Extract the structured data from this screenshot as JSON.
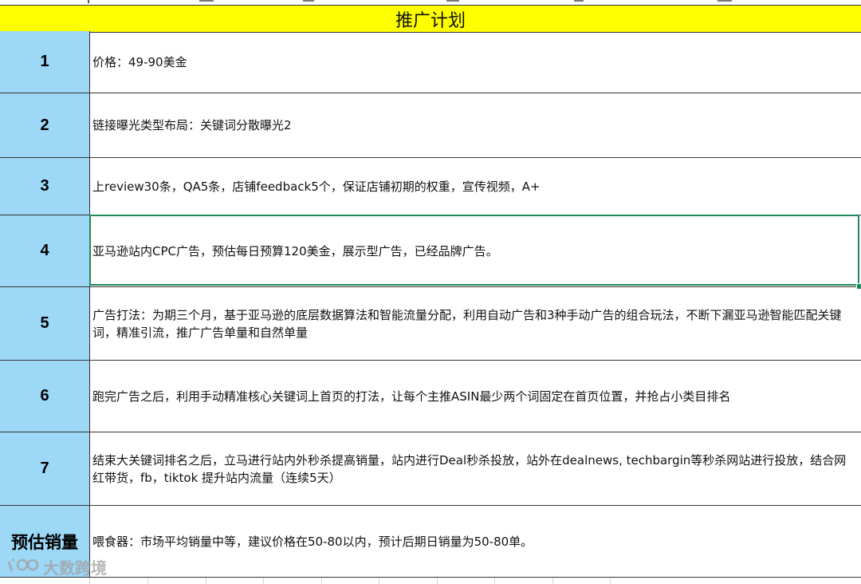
{
  "title": "推广计划",
  "rows": [
    {
      "num": "1",
      "text": "价格：49-90美金"
    },
    {
      "num": "2",
      "text": "链接曝光类型布局：关键词分散曝光2"
    },
    {
      "num": "3",
      "text": "上review30条，QA5条，店铺feedback5个，保证店铺初期的权重，宣传视频，A+"
    },
    {
      "num": "4",
      "text": "亚马逊站内CPC广告，预估每日预算120美金，展示型广告，已经品牌广告。"
    },
    {
      "num": "5",
      "text": "广告打法：为期三个月，基于亚马逊的底层数据算法和智能流量分配，利用自动广告和3种手动广告的组合玩法，不断下漏亚马逊智能匹配关键词，精准引流，推广广告单量和自然单量"
    },
    {
      "num": "6",
      "text": "跑完广告之后，利用手动精准核心关键词上首页的打法，让每个主推ASIN最少两个词固定在首页位置，并抢占小类目排名"
    },
    {
      "num": "7",
      "text": "结束大关键词排名之后，立马进行站内外秒杀提高销量，站内进行Deal秒杀投放，站外在dealnews, techbargin等秒杀网站进行投放，结合网红带货，fb，tiktok 提升站内流量（连续5天）"
    },
    {
      "num": "预估销量",
      "text": "喂食器：市场平均销量中等，建议价格在50-80以内，预计后期日销量为50-80单。"
    }
  ],
  "watermark": {
    "text": "大数跨境",
    "icon": "logo-icon"
  },
  "colors": {
    "title_bg": "#ffff00",
    "num_bg": "#9dd8f7",
    "selection": "#1f8a5a"
  }
}
